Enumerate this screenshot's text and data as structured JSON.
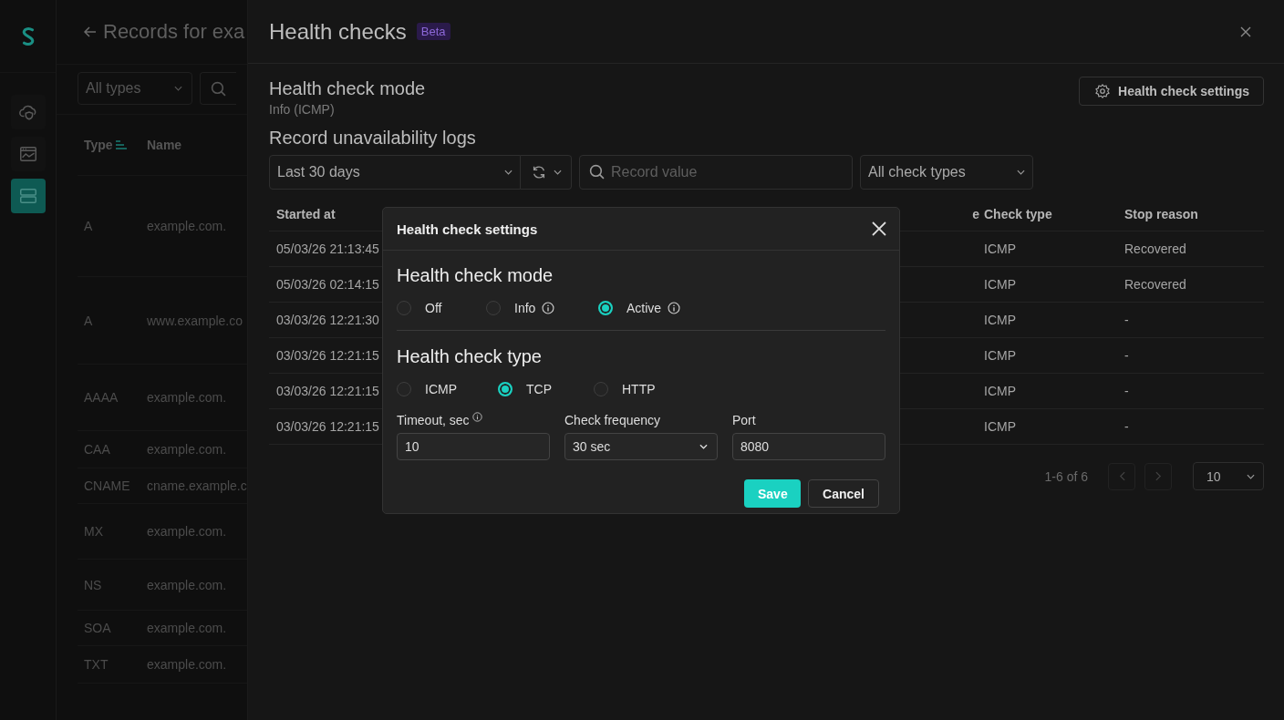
{
  "sidebar": {
    "items": [
      {
        "kind": "cloud",
        "selected": false
      },
      {
        "kind": "monitor",
        "selected": false
      },
      {
        "kind": "servers",
        "selected": true
      }
    ]
  },
  "records_page": {
    "title": "Records for exa",
    "type_filter": "All types",
    "columns": [
      "Type",
      "Name"
    ],
    "rows": [
      {
        "type": "A",
        "name": "example.com."
      },
      {
        "type": "A",
        "name": "www.example.co"
      },
      {
        "type": "AAAA",
        "name": "example.com."
      },
      {
        "type": "CAA",
        "name": "example.com."
      },
      {
        "type": "CNAME",
        "name": "cname.example.c"
      },
      {
        "type": "MX",
        "name": "example.com."
      },
      {
        "type": "NS",
        "name": "example.com."
      },
      {
        "type": "SOA",
        "name": "example.com."
      },
      {
        "type": "TXT",
        "name": "example.com."
      }
    ]
  },
  "drawer": {
    "title": "Health checks",
    "badge": "Beta",
    "mode_heading": "Health check mode",
    "mode_value": "Info (ICMP)",
    "settings_button": "Health check settings",
    "logs_heading": "Record unavailability logs",
    "period_filter": "Last 30 days",
    "search": {
      "placeholder": "Record value"
    },
    "check_type_filter": "All check types",
    "table": {
      "columns": [
        "Started at",
        "e",
        "Check type",
        "Stop reason"
      ],
      "rows": [
        {
          "started_at": "05/03/26 21:13:45",
          "check_type": "ICMP",
          "stop_reason": "Recovered"
        },
        {
          "started_at": "05/03/26 02:14:15",
          "check_type": "ICMP",
          "stop_reason": "Recovered"
        },
        {
          "started_at": "03/03/26 12:21:30",
          "check_type": "ICMP",
          "stop_reason": "-"
        },
        {
          "started_at": "03/03/26 12:21:15",
          "check_type": "ICMP",
          "stop_reason": "-"
        },
        {
          "started_at": "03/03/26 12:21:15",
          "check_type": "ICMP",
          "stop_reason": "-"
        },
        {
          "started_at": "03/03/26 12:21:15",
          "check_type": "ICMP",
          "stop_reason": "-"
        }
      ]
    },
    "pagination": {
      "range": "1-6 of 6",
      "page_size": "10"
    }
  },
  "dialog": {
    "title": "Health check settings",
    "mode_heading": "Health check mode",
    "modes": [
      {
        "label": "Off",
        "selected": false,
        "info": false
      },
      {
        "label": "Info",
        "selected": false,
        "info": true
      },
      {
        "label": "Active",
        "selected": true,
        "info": true
      }
    ],
    "type_heading": "Health check type",
    "types": [
      {
        "label": "ICMP",
        "selected": false
      },
      {
        "label": "TCP",
        "selected": true
      },
      {
        "label": "HTTP",
        "selected": false
      }
    ],
    "fields": [
      {
        "kind": "input",
        "label": "Timeout, sec",
        "info": true,
        "value": "10"
      },
      {
        "kind": "select",
        "label": "Check frequency",
        "info": false,
        "value": "30 sec"
      },
      {
        "kind": "input",
        "label": "Port",
        "info": false,
        "value": "8080"
      }
    ],
    "buttons": [
      {
        "label": "Save",
        "kind": "primary"
      },
      {
        "label": "Cancel",
        "kind": "secondary"
      }
    ]
  }
}
